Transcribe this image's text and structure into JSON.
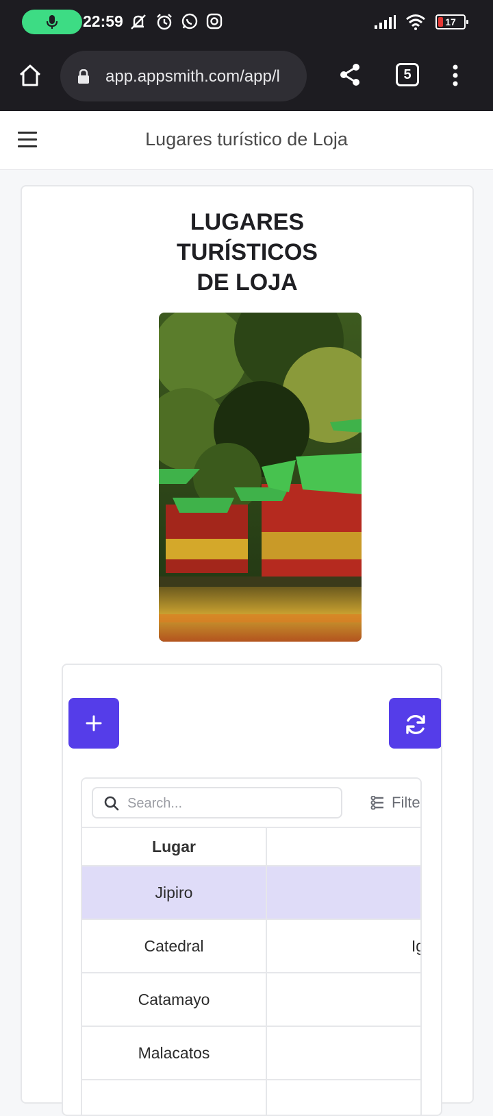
{
  "status_bar": {
    "time": "22:59",
    "battery_level": "17",
    "icons": [
      "mic-icon",
      "mute-icon",
      "alarm-icon",
      "whatsapp-icon",
      "instagram-icon",
      "signal-icon",
      "wifi-icon",
      "battery-icon"
    ]
  },
  "browser": {
    "url": "app.appsmith.com/app/l",
    "tab_count": "5",
    "icons": [
      "home-icon",
      "lock-icon",
      "share-icon",
      "tabs-icon",
      "more-vert-icon"
    ]
  },
  "app_header": {
    "title": "Lugares turístico de Loja"
  },
  "page": {
    "heading": "LUGARES\nTURÍSTICOS\nDE LOJA"
  },
  "toolbar": {
    "add_icon": "plus-icon",
    "refresh_icon": "refresh-icon"
  },
  "table": {
    "search_placeholder": "Search...",
    "filter_label": "Filte",
    "columns": [
      "Lugar",
      ""
    ],
    "rows": [
      {
        "lugar": "Jipiro",
        "second": ""
      },
      {
        "lugar": "Catedral",
        "second": "Ig"
      },
      {
        "lugar": "Catamayo",
        "second": ""
      },
      {
        "lugar": "Malacatos",
        "second": ""
      }
    ]
  },
  "colors": {
    "accent": "#553de9",
    "selected_row": "#dfdcf8",
    "mic_pill": "#3ddc84",
    "system_bar": "#1d1c21"
  }
}
